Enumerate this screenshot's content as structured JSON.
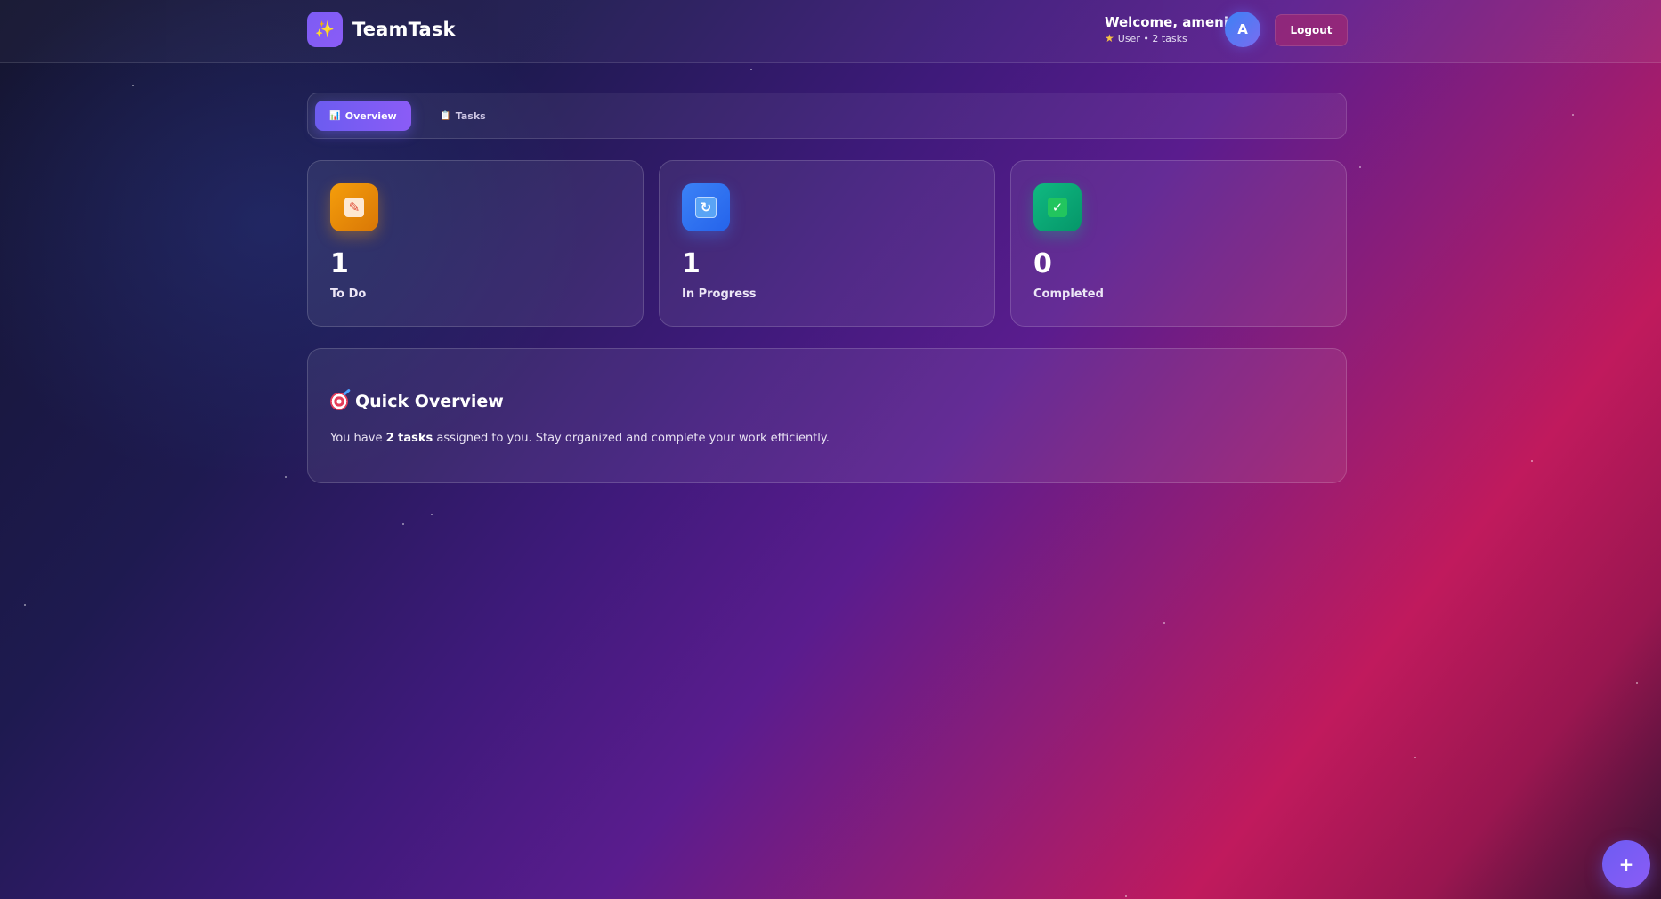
{
  "header": {
    "app_name": "TeamTask",
    "logo_icon": "sparkles-icon",
    "welcome_text": "Welcome, ameni!",
    "user_role_icon": "star-icon",
    "user_meta": "User • 2 tasks",
    "avatar_initial": "A",
    "logout_label": "Logout"
  },
  "tabs": [
    {
      "label": "Overview",
      "icon": "chart-icon",
      "active": true
    },
    {
      "label": "Tasks",
      "icon": "clipboard-icon",
      "active": false
    }
  ],
  "stats": [
    {
      "value": "1",
      "label": "To Do",
      "icon": "memo-icon",
      "color": "#f59e0b"
    },
    {
      "value": "1",
      "label": "In Progress",
      "icon": "refresh-icon",
      "color": "#3b82f6"
    },
    {
      "value": "0",
      "label": "Completed",
      "icon": "check-icon",
      "color": "#10b981"
    }
  ],
  "overview": {
    "title": "Quick Overview",
    "icon": "target-icon",
    "text_before": "You have ",
    "text_bold": "2 tasks",
    "text_after": " assigned to you. Stay organized and complete your work efficiently."
  },
  "fab": {
    "label": "+"
  },
  "colors": {
    "accent": "#7c5cf4",
    "logout": "#a8286e",
    "todo": "#f59e0b",
    "in_progress": "#3b82f6",
    "completed": "#10b981"
  }
}
